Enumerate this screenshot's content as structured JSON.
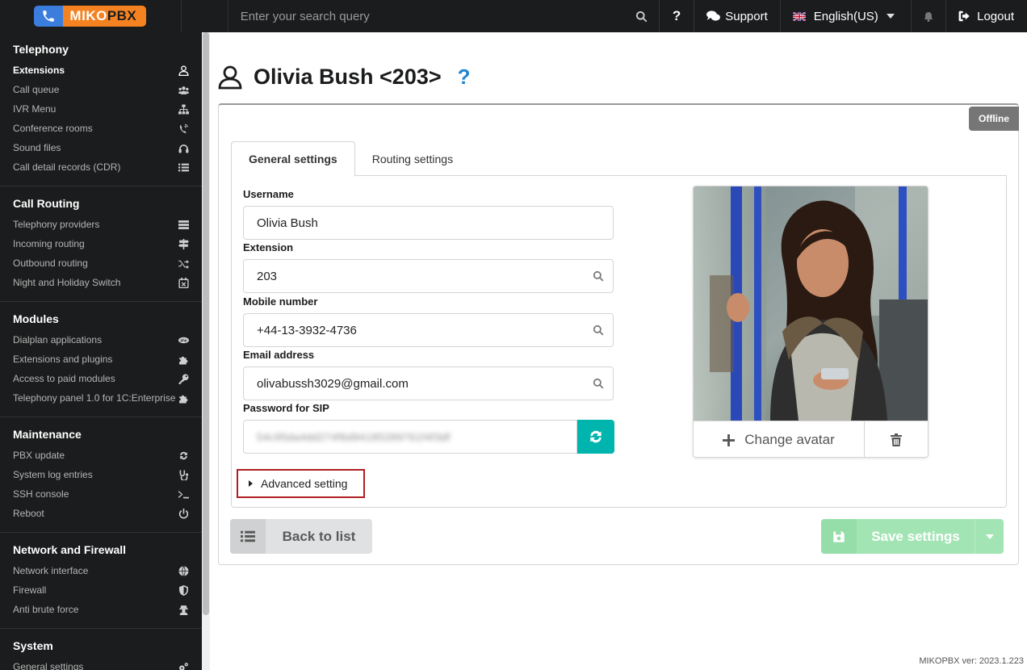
{
  "topbar": {
    "logo_text_a": "MIKO",
    "logo_text_b": "PBX",
    "search_placeholder": "Enter your search query",
    "help_icon": "question-icon",
    "support_label": "Support",
    "language_label": "English(US)",
    "logout_label": "Logout"
  },
  "sidebar": {
    "groups": [
      {
        "title": "Telephony",
        "items": [
          {
            "label": "Extensions",
            "icon": "user-icon"
          },
          {
            "label": "Call queue",
            "icon": "users-icon"
          },
          {
            "label": "IVR Menu",
            "icon": "sitemap-icon"
          },
          {
            "label": "Conference rooms",
            "icon": "phone-volume-icon"
          },
          {
            "label": "Sound files",
            "icon": "headphones-icon"
          },
          {
            "label": "Call detail records (CDR)",
            "icon": "list-icon"
          }
        ]
      },
      {
        "title": "Call Routing",
        "items": [
          {
            "label": "Telephony providers",
            "icon": "server-icon"
          },
          {
            "label": "Incoming routing",
            "icon": "sign-icon"
          },
          {
            "label": "Outbound routing",
            "icon": "random-icon"
          },
          {
            "label": "Night and Holiday Switch",
            "icon": "calendar-icon"
          }
        ]
      },
      {
        "title": "Modules",
        "items": [
          {
            "label": "Dialplan applications",
            "icon": "php-icon"
          },
          {
            "label": "Extensions and plugins",
            "icon": "puzzle-icon"
          },
          {
            "label": "Access to paid modules",
            "icon": "key-icon"
          },
          {
            "label": "Telephony panel 1.0 for 1C:Enterprise",
            "icon": "puzzle-icon"
          }
        ]
      },
      {
        "title": "Maintenance",
        "items": [
          {
            "label": "PBX update",
            "icon": "sync-icon"
          },
          {
            "label": "System log entries",
            "icon": "stethoscope-icon"
          },
          {
            "label": "SSH console",
            "icon": "terminal-icon"
          },
          {
            "label": "Reboot",
            "icon": "power-icon"
          }
        ]
      },
      {
        "title": "Network and Firewall",
        "items": [
          {
            "label": "Network interface",
            "icon": "globe-icon"
          },
          {
            "label": "Firewall",
            "icon": "shield-icon"
          },
          {
            "label": "Anti brute force",
            "icon": "user-secret-icon"
          }
        ]
      },
      {
        "title": "System",
        "items": [
          {
            "label": "General settings",
            "icon": "cogs-icon"
          }
        ]
      }
    ]
  },
  "page": {
    "title": "Olivia Bush <203>",
    "status_badge": "Offline",
    "tabs": [
      "General settings",
      "Routing settings"
    ],
    "fields": {
      "username_label": "Username",
      "username_value": "Olivia Bush",
      "extension_label": "Extension",
      "extension_value": "203",
      "mobile_label": "Mobile number",
      "mobile_value": "+44-13-3932-4736",
      "email_label": "Email address",
      "email_value": "olivabussh3029@gmail.com",
      "password_label": "Password for SIP",
      "password_value": "54c95da4dd274f6d94185289761f4f3df"
    },
    "advanced_label": "Advanced setting",
    "change_avatar_label": "Change avatar",
    "back_label": "Back to list",
    "save_label": "Save settings"
  },
  "footer": {
    "version": "MIKOPBX ver: 2023.1.223"
  },
  "colors": {
    "sidebar_bg": "#1b1c1d",
    "teal": "#00b5ad",
    "save_green": "#a3e4b4",
    "logo_orange": "#f58220",
    "logo_blue": "#3b7ddd",
    "help_blue": "#2185d0",
    "highlight_red": "#b01e23"
  }
}
